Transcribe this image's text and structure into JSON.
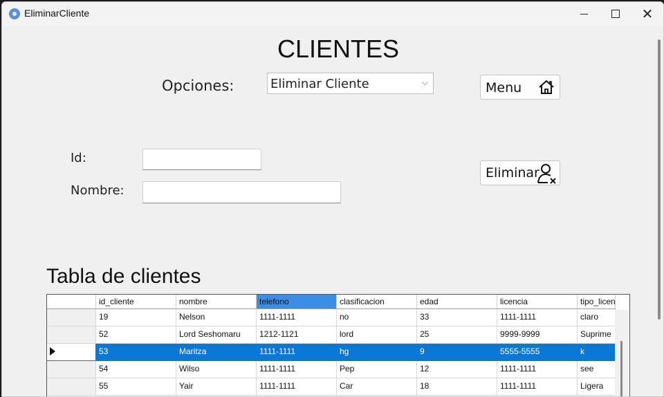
{
  "window": {
    "title": "EliminarCliente"
  },
  "heading": "CLIENTES",
  "options": {
    "label": "Opciones:",
    "selected": "Eliminar Cliente"
  },
  "buttons": {
    "menu": "Menu",
    "eliminar": "Eliminar"
  },
  "form": {
    "id_label": "Id:",
    "id_value": "",
    "nombre_label": "Nombre:",
    "nombre_value": ""
  },
  "table": {
    "title": "Tabla de clientes",
    "headers": [
      "id_cliente",
      "nombre",
      "telefono",
      "clasificacion",
      "edad",
      "licencia",
      "tipo_licen"
    ],
    "selected_header": "telefono",
    "rows": [
      [
        "19",
        "Nelson",
        "1111-1111",
        "no",
        "33",
        "1111-1111",
        "claro"
      ],
      [
        "52",
        "Lord Seshomaru",
        "1212-1121",
        "lord",
        "25",
        "9999-9999",
        "Suprime"
      ],
      [
        "53",
        "Maritza",
        "1111-1111",
        "hg",
        "9",
        "5555-5555",
        "k"
      ],
      [
        "54",
        "Wilso",
        "1111-1111",
        "Pep",
        "12",
        "1111-1111",
        "see"
      ],
      [
        "55",
        "Yair",
        "1111-1111",
        "Car",
        "18",
        "1111-1111",
        "Ligera"
      ]
    ],
    "selected_row_index": 2
  },
  "icons": {
    "app": "gear-app-icon",
    "menu": "home-icon",
    "eliminar": "remove-user-icon"
  }
}
